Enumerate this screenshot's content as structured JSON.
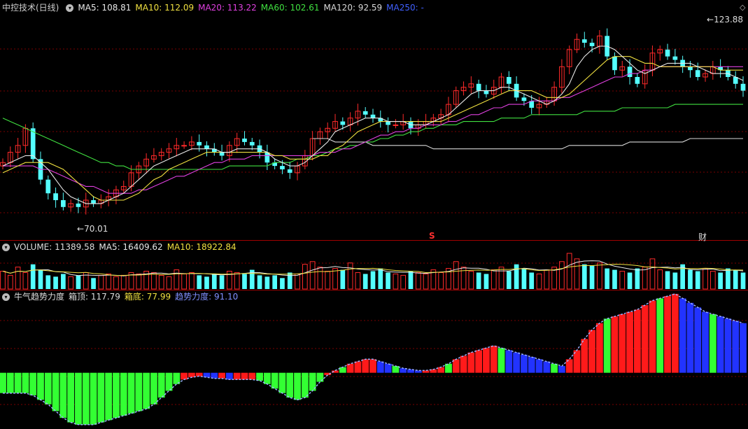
{
  "main": {
    "title": "中控技术(日线)",
    "ma": [
      {
        "label": "MA5: 108.81",
        "color": "#e8e8e8"
      },
      {
        "label": "MA10: 112.09",
        "color": "#f0e040"
      },
      {
        "label": "MA20: 113.22",
        "color": "#e040e0"
      },
      {
        "label": "MA60: 102.61",
        "color": "#40e040"
      },
      {
        "label": "MA120: 92.59",
        "color": "#d8d8d8"
      },
      {
        "label": "MA250: -",
        "color": "#4060ff"
      }
    ],
    "high_label": "123.88",
    "low_label": "70.01",
    "marker_s": "S",
    "marker_cai": "财"
  },
  "volume": {
    "label": "VOLUME: 11389.58",
    "ma5": "MA5: 16409.62",
    "ma10": "MA10: 18922.84"
  },
  "indicator": {
    "name": "牛气趋势力度",
    "box_top": "箱顶: 117.79",
    "box_bottom": "箱底: 77.99",
    "strength": "趋势力度: 91.10"
  },
  "colors": {
    "up": "#ff2a2a",
    "down": "#54ffff",
    "ma5": "#e8e8e8",
    "ma10": "#f0e040",
    "ma20": "#e040e0",
    "ma60": "#40e040",
    "ma120": "#d8d8d8",
    "grid": "#7a0000",
    "ind_red": "#ff1a1a",
    "ind_green": "#33ff33",
    "ind_blue": "#2233ff"
  },
  "chart_data": [
    {
      "type": "candlestick",
      "title": "中控技术(日线)",
      "close": [
        85,
        88,
        90,
        95,
        86,
        80,
        76,
        74,
        72,
        73,
        72,
        74,
        73,
        74,
        75,
        77,
        78,
        82,
        84,
        86,
        87,
        88,
        89,
        90,
        90,
        91,
        90,
        89,
        88,
        87,
        90,
        92,
        91,
        90,
        88,
        85,
        84,
        83,
        82,
        84,
        87,
        92,
        94,
        95,
        97,
        96,
        98,
        100,
        99,
        98,
        97,
        96,
        96,
        97,
        95,
        96,
        97,
        98,
        99,
        102,
        106,
        107,
        108,
        106,
        105,
        107,
        110,
        108,
        104,
        103,
        101,
        102,
        103,
        107,
        113,
        118,
        121,
        120,
        119,
        122,
        116,
        112,
        113,
        110,
        108,
        112,
        117,
        118,
        116,
        115,
        113,
        112,
        110,
        111,
        113,
        112,
        110,
        108,
        106
      ],
      "ma5": [
        84,
        85,
        86,
        87,
        87,
        85,
        83,
        80,
        77,
        75,
        74,
        73,
        73,
        73,
        74,
        75,
        76,
        78,
        80,
        82,
        84,
        85,
        86,
        87,
        88,
        89,
        89,
        89,
        89,
        88,
        88,
        89,
        89,
        89,
        89,
        88,
        86,
        85,
        84,
        84,
        85,
        87,
        89,
        91,
        94,
        95,
        96,
        97,
        98,
        98,
        98,
        97,
        97,
        97,
        96,
        96,
        96,
        97,
        98,
        99,
        101,
        103,
        105,
        106,
        106,
        106,
        107,
        107,
        106,
        105,
        104,
        103,
        102,
        103,
        105,
        108,
        113,
        116,
        118,
        119,
        119,
        118,
        116,
        114,
        112,
        111,
        112,
        113,
        114,
        114,
        114,
        114,
        113,
        112,
        111,
        111,
        111,
        110,
        109
      ],
      "ma10": [
        82,
        83,
        84,
        85,
        85,
        85,
        85,
        84,
        83,
        81,
        79,
        77,
        75,
        74,
        74,
        74,
        74,
        75,
        76,
        78,
        80,
        81,
        83,
        84,
        85,
        86,
        87,
        88,
        88,
        88,
        88,
        88,
        88,
        88,
        88,
        88,
        87,
        87,
        86,
        86,
        86,
        86,
        87,
        87,
        89,
        90,
        92,
        94,
        95,
        96,
        97,
        97,
        97,
        97,
        97,
        97,
        97,
        97,
        97,
        98,
        99,
        100,
        101,
        102,
        103,
        104,
        105,
        106,
        106,
        106,
        106,
        105,
        104,
        104,
        104,
        105,
        107,
        109,
        111,
        113,
        115,
        116,
        116,
        116,
        115,
        114,
        114,
        113,
        113,
        113,
        113,
        113,
        113,
        113,
        113,
        112,
        112,
        112,
        112
      ],
      "ma20": [
        84,
        84,
        84,
        84,
        84,
        83,
        83,
        82,
        81,
        80,
        79,
        78,
        78,
        77,
        76,
        76,
        76,
        76,
        77,
        77,
        78,
        79,
        80,
        81,
        81,
        82,
        83,
        84,
        85,
        85,
        86,
        86,
        86,
        87,
        87,
        87,
        87,
        87,
        87,
        87,
        87,
        87,
        88,
        88,
        88,
        89,
        89,
        90,
        91,
        92,
        93,
        93,
        94,
        94,
        95,
        95,
        96,
        96,
        96,
        97,
        97,
        98,
        99,
        99,
        100,
        101,
        101,
        102,
        102,
        102,
        103,
        103,
        103,
        103,
        104,
        104,
        105,
        106,
        107,
        108,
        109,
        110,
        110,
        111,
        111,
        112,
        112,
        113,
        113,
        113,
        113,
        113,
        113,
        113,
        113,
        113,
        113,
        113,
        113
      ],
      "ma60": [
        98,
        97,
        96,
        95,
        94,
        93,
        92,
        91,
        90,
        89,
        88,
        87,
        86,
        85,
        85,
        84,
        84,
        83,
        83,
        83,
        83,
        83,
        83,
        83,
        83,
        83,
        83,
        83,
        83,
        83,
        84,
        84,
        84,
        84,
        84,
        84,
        85,
        85,
        85,
        86,
        86,
        87,
        87,
        88,
        89,
        89,
        90,
        90,
        91,
        91,
        92,
        92,
        93,
        93,
        94,
        94,
        95,
        95,
        96,
        96,
        96,
        97,
        97,
        97,
        97,
        97,
        98,
        98,
        98,
        98,
        99,
        99,
        99,
        99,
        99,
        99,
        99,
        100,
        100,
        100,
        100,
        100,
        101,
        101,
        101,
        101,
        101,
        101,
        101,
        102,
        102,
        102,
        102,
        102,
        102,
        102,
        102,
        102,
        102
      ],
      "ma120": [
        null,
        null,
        null,
        null,
        null,
        null,
        null,
        null,
        null,
        null,
        null,
        null,
        null,
        null,
        null,
        null,
        null,
        null,
        null,
        null,
        null,
        null,
        null,
        null,
        null,
        null,
        null,
        null,
        null,
        null,
        null,
        null,
        null,
        null,
        null,
        null,
        null,
        null,
        null,
        null,
        null,
        92,
        92,
        92,
        91,
        91,
        91,
        91,
        91,
        90,
        90,
        90,
        90,
        90,
        90,
        90,
        90,
        89,
        89,
        89,
        89,
        89,
        89,
        89,
        89,
        89,
        89,
        89,
        89,
        89,
        89,
        89,
        89,
        89,
        89,
        90,
        90,
        90,
        90,
        90,
        90,
        90,
        90,
        91,
        91,
        91,
        91,
        91,
        91,
        91,
        91,
        92,
        92,
        92,
        92,
        92,
        92,
        92,
        92
      ],
      "ylim": [
        65,
        128
      ]
    },
    {
      "type": "bar",
      "title": "VOLUME",
      "values": [
        13,
        10,
        16,
        12,
        18,
        14,
        10,
        9,
        11,
        9,
        10,
        12,
        8,
        10,
        11,
        9,
        10,
        12,
        11,
        13,
        12,
        10,
        9,
        14,
        11,
        12,
        10,
        9,
        11,
        10,
        13,
        12,
        11,
        14,
        10,
        9,
        10,
        8,
        12,
        11,
        18,
        20,
        16,
        13,
        15,
        14,
        19,
        12,
        11,
        13,
        15,
        12,
        11,
        10,
        13,
        12,
        11,
        14,
        12,
        15,
        20,
        16,
        13,
        12,
        11,
        14,
        16,
        13,
        18,
        15,
        12,
        11,
        14,
        16,
        20,
        26,
        22,
        18,
        17,
        19,
        15,
        14,
        13,
        12,
        15,
        16,
        22,
        14,
        13,
        12,
        18,
        14,
        13,
        15,
        13,
        12,
        15,
        14,
        12
      ]
    },
    {
      "type": "bar",
      "title": "牛气趋势力度",
      "values": [
        -18,
        -18,
        -18,
        -18,
        -20,
        -24,
        -28,
        -34,
        -40,
        -44,
        -46,
        -46,
        -46,
        -44,
        -42,
        -40,
        -38,
        -36,
        -34,
        -32,
        -28,
        -22,
        -16,
        -10,
        -6,
        -4,
        -3,
        -4,
        -5,
        -5,
        -6,
        -6,
        -6,
        -6,
        -7,
        -10,
        -14,
        -18,
        -22,
        -24,
        -22,
        -16,
        -8,
        -2,
        2,
        5,
        8,
        10,
        12,
        12,
        10,
        8,
        6,
        4,
        3,
        2,
        2,
        3,
        5,
        8,
        12,
        15,
        18,
        20,
        22,
        24,
        22,
        20,
        18,
        16,
        14,
        12,
        10,
        8,
        6,
        12,
        20,
        30,
        38,
        44,
        48,
        50,
        52,
        54,
        56,
        60,
        64,
        66,
        68,
        70,
        66,
        62,
        58,
        54,
        52,
        50,
        48,
        46,
        44
      ]
    }
  ]
}
